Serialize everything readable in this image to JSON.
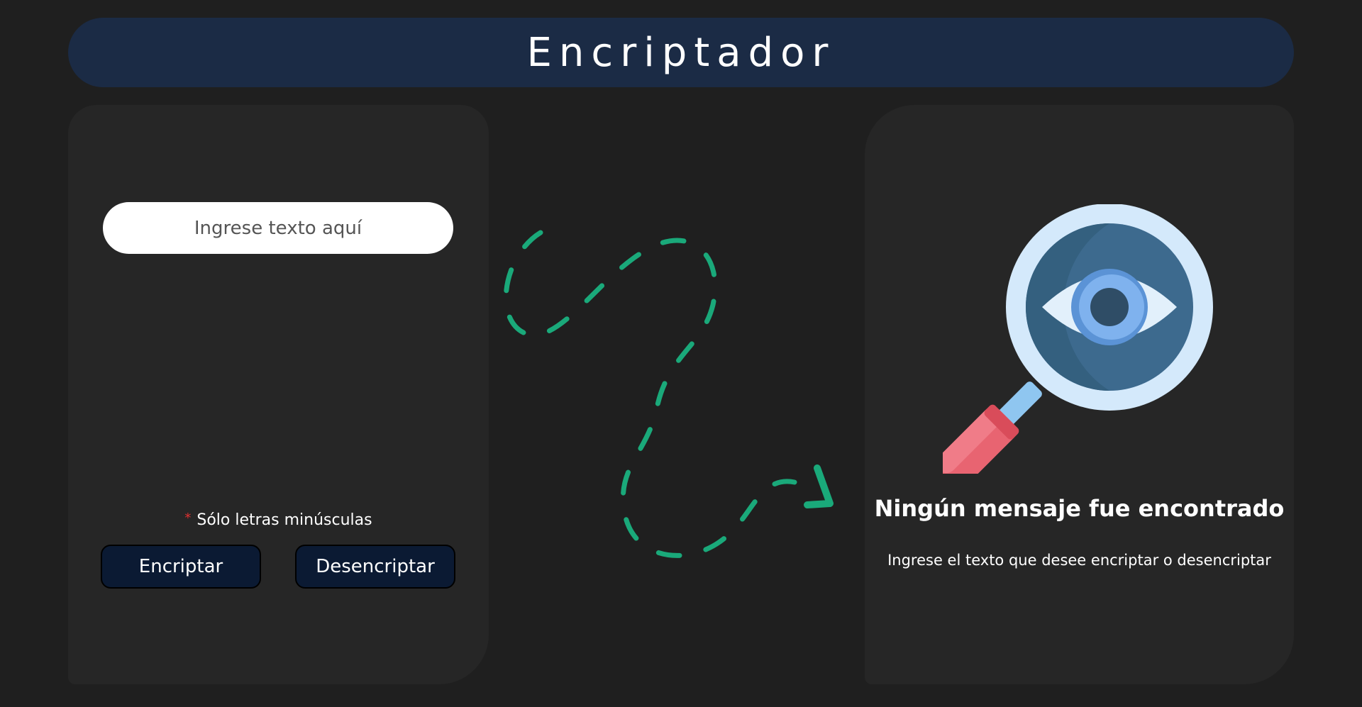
{
  "header": {
    "title": "Encriptador"
  },
  "input_panel": {
    "input_placeholder": "Ingrese texto aquí",
    "input_value": "",
    "hint_marker": "*",
    "hint_text": "Sólo letras minúsculas",
    "encrypt_label": "Encriptar",
    "decrypt_label": "Desencriptar"
  },
  "output_panel": {
    "illustration_icon": "magnifier-eye-icon",
    "title": "Ningún mensaje fue encontrado",
    "subtitle": "Ingrese el texto que desee encriptar o desencriptar"
  },
  "decoration": {
    "arrow_icon": "dashed-curved-arrow-icon"
  },
  "colors": {
    "background": "#1f1f1f",
    "header": "#1b2b45",
    "panel": "#262626",
    "button": "#0b1a33",
    "arrow": "#1aa97a",
    "hint_marker": "#e03030"
  }
}
